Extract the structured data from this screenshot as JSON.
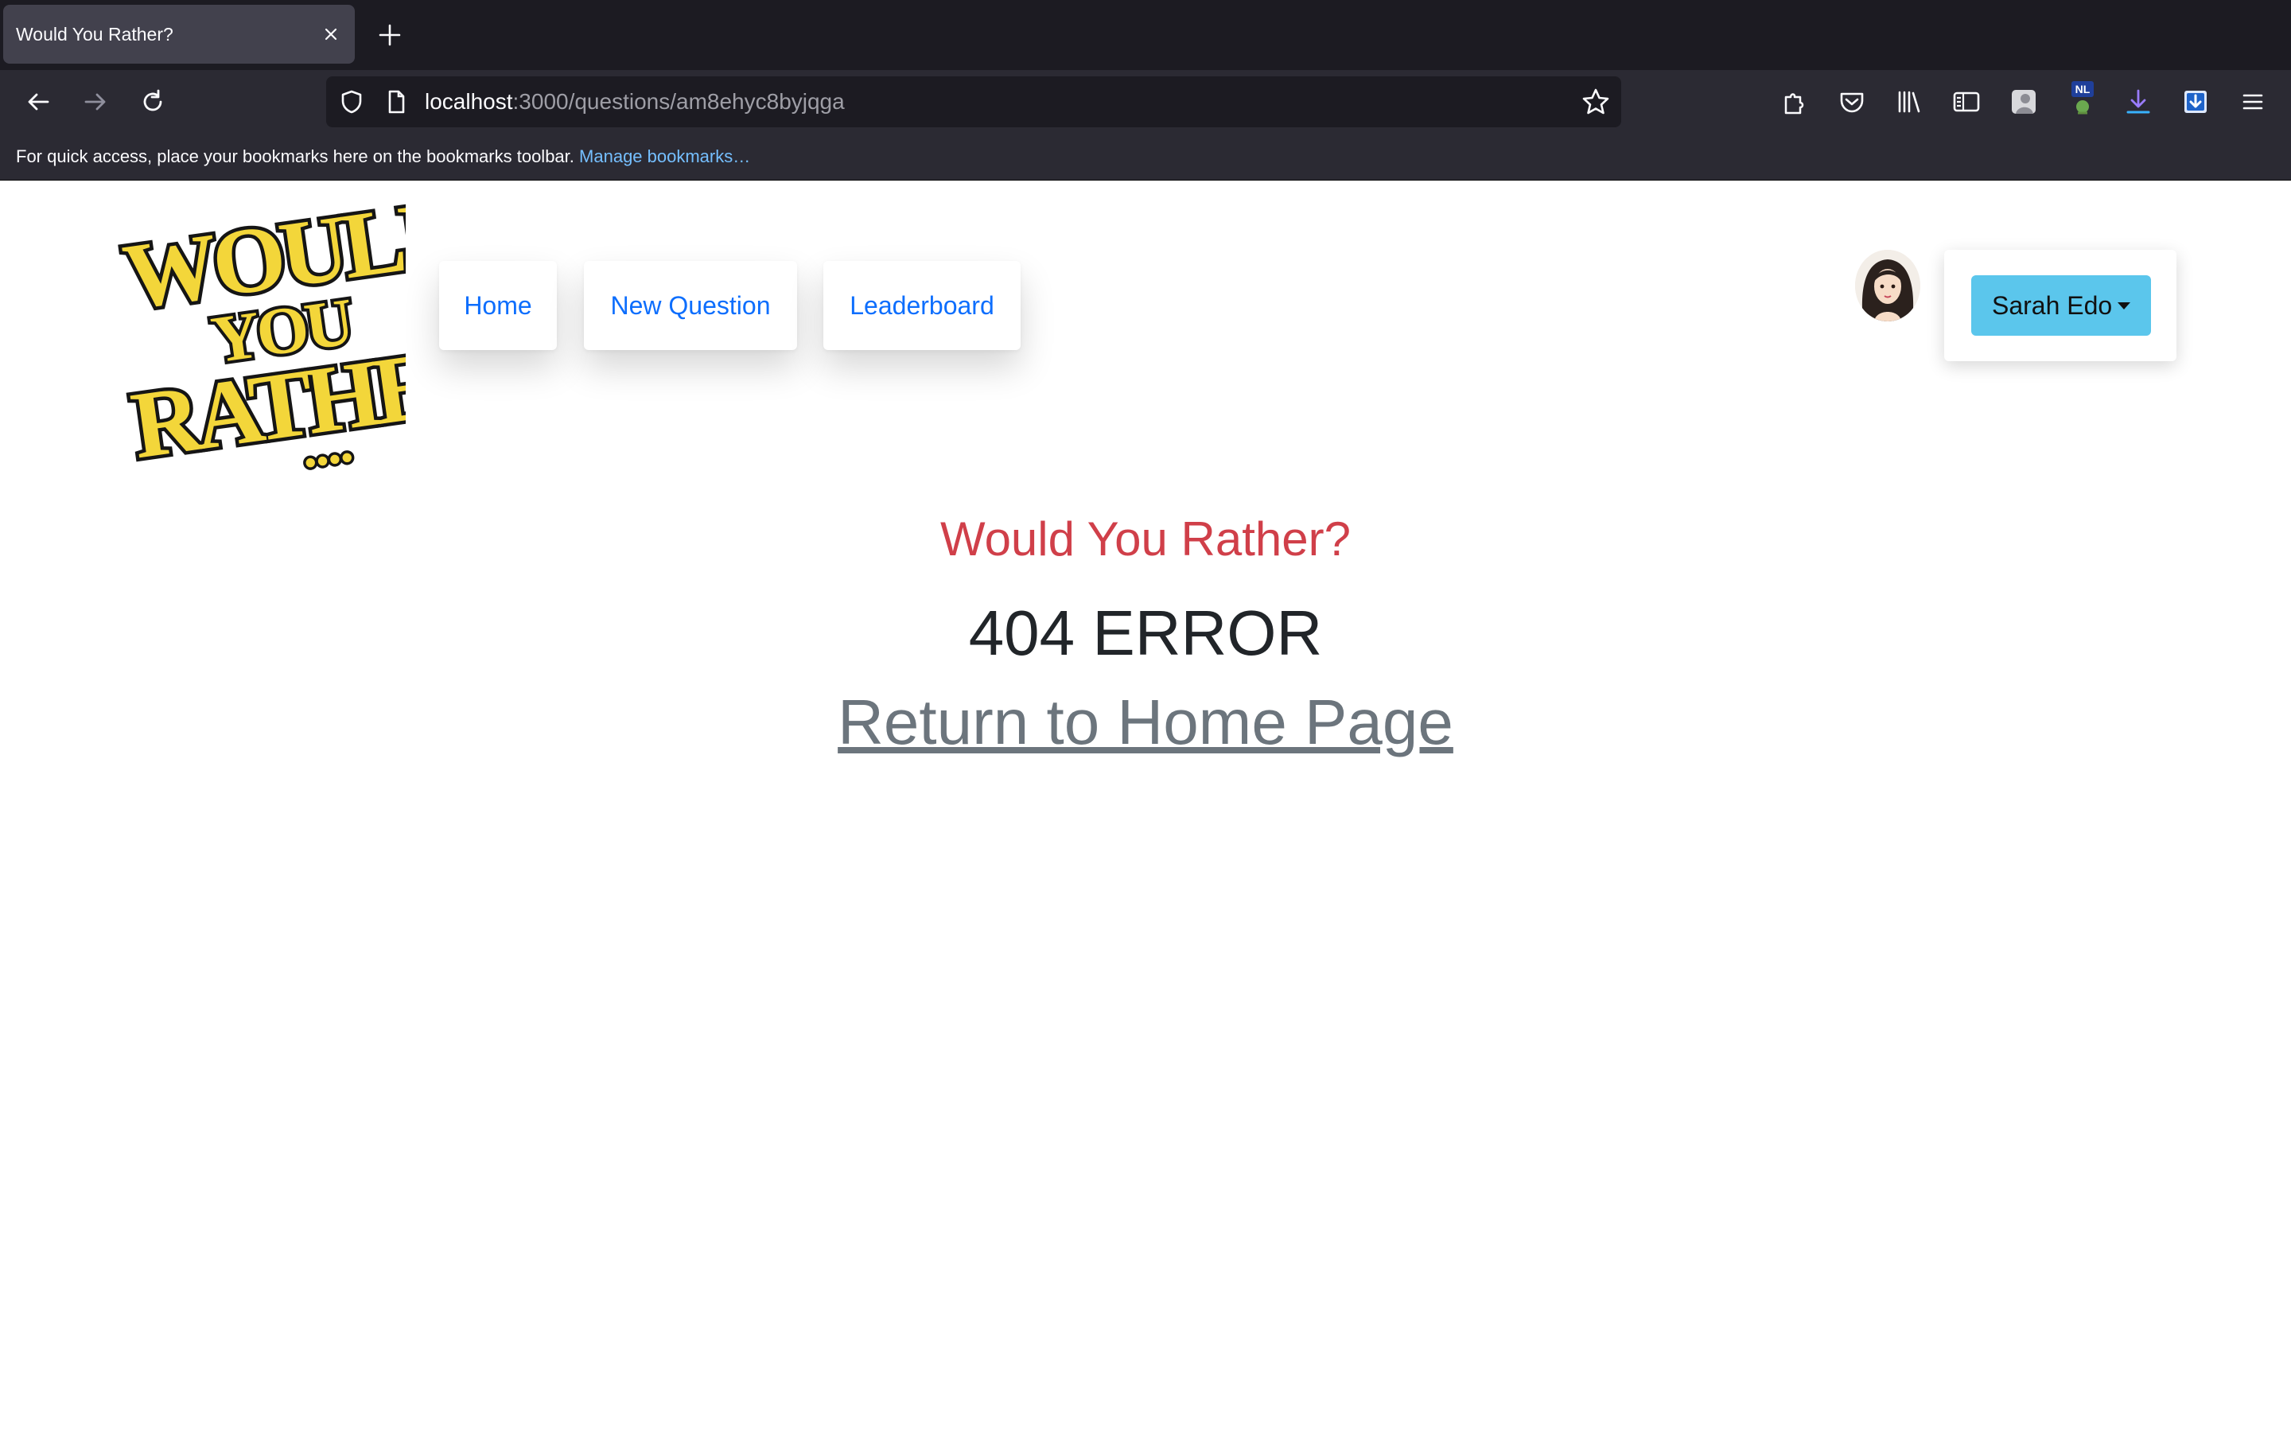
{
  "browser": {
    "tab_title": "Would You Rather?",
    "url_host": "localhost",
    "url_path": ":3000/questions/am8ehyc8byjqga",
    "bookmarks_message": "For quick access, place your bookmarks here on the bookmarks toolbar.",
    "bookmarks_link": "Manage bookmarks…",
    "extension_badge": "NL"
  },
  "header": {
    "logo_text": "Would You Rather?....",
    "nav": [
      {
        "label": "Home"
      },
      {
        "label": "New Question"
      },
      {
        "label": "Leaderboard"
      }
    ],
    "user": {
      "name": "Sarah Edo"
    }
  },
  "main": {
    "title": "Would You Rather?",
    "error": "404 ERROR",
    "home_link": "Return to Home Page"
  },
  "colors": {
    "accent_link": "#0d6efd",
    "title_red": "#d03f49",
    "user_button": "#5bc6ec",
    "logo_yellow": "#f3d63a"
  }
}
